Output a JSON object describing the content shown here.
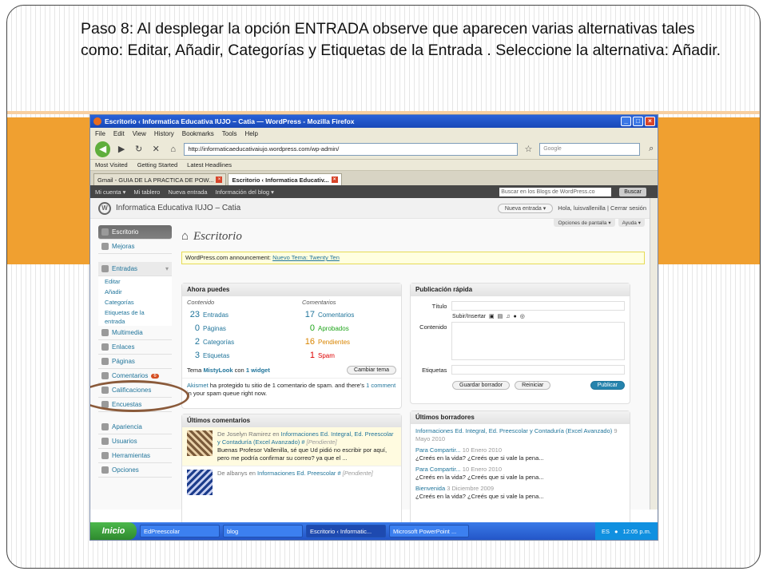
{
  "slide": {
    "heading": "Paso 8: Al desplegar la opción ENTRADA observe que aparecen varias alternativas tales como: Editar, Añadir, Categorías y Etiquetas de la Entrada . Seleccione la alternativa: Añadir."
  },
  "browser": {
    "title": "Escritorio ‹ Informatica Educativa IUJO – Catia — WordPress - Mozilla Firefox",
    "menu": [
      "File",
      "Edit",
      "View",
      "History",
      "Bookmarks",
      "Tools",
      "Help"
    ],
    "url": "http://informaticaeducativaiujo.wordpress.com/wp-admin/",
    "search_placeholder": "Google",
    "bookmarks": [
      "Most Visited",
      "Getting Started",
      "Latest Headlines"
    ],
    "tabs": [
      "Gmail - GUIA DE LA PRACTICA DE POW...",
      "Escritorio ‹ Informatica Educativ..."
    ]
  },
  "wpbar": {
    "items": [
      "Mi cuenta ▾",
      "Mi tablero",
      "Nueva entrada",
      "Información del blog ▾"
    ],
    "search_placeholder": "Buscar en los Blogs de WordPress.co",
    "search_button": "Buscar"
  },
  "header": {
    "site": "Informatica Educativa IUJO – Catia",
    "new_post": "Nueva entrada",
    "greeting": "Hola,",
    "user": "luisvallenilla",
    "logout": "Cerrar sesión"
  },
  "sidebar": {
    "escritorio": "Escritorio",
    "mejoras": "Mejoras",
    "entradas": "Entradas",
    "sub": [
      "Editar",
      "Añadir",
      "Categorías",
      "Etiquetas de la",
      "entrada"
    ],
    "items": [
      "Multimedia",
      "Enlaces",
      "Páginas",
      "Comentarios",
      "Calificaciones",
      "Encuestas"
    ],
    "comments_badge": "6",
    "items2": [
      "Apariencia",
      "Usuarios",
      "Herramientas",
      "Opciones"
    ]
  },
  "page": {
    "title": "Escritorio",
    "screen_options": "Opciones de pantalla ▾",
    "help": "Ayuda ▾",
    "notice_prefix": "WordPress.com announcement:",
    "notice_link": "Nuevo Tema: Twenty Ten"
  },
  "ahora": {
    "title": "Ahora puedes",
    "col1": "Contenido",
    "col2": "Comentarios",
    "left": [
      {
        "n": "23",
        "label": "Entradas"
      },
      {
        "n": "0",
        "label": "Páginas"
      },
      {
        "n": "2",
        "label": "Categorías"
      },
      {
        "n": "3",
        "label": "Etiquetas"
      }
    ],
    "right": [
      {
        "n": "17",
        "label": "Comentarios"
      },
      {
        "n": "0",
        "label": "Aprobados"
      },
      {
        "n": "16",
        "label": "Pendientes"
      },
      {
        "n": "1",
        "label": "Spam"
      }
    ],
    "theme_prefix": "Tema",
    "theme": "MistyLook",
    "theme_mid": "con",
    "widgets": "1 widget",
    "change_theme": "Cambiar tema",
    "akismet": "Akismet",
    "akismet_text": "ha protegido tu sitio de 1 comentario de spam. and there's",
    "akismet_link": "1 comment",
    "akismet_end": "in your spam queue right now."
  },
  "comentarios": {
    "title": "Últimos comentarios",
    "c1_author": "De Joselyn Ramirez en",
    "c1_post": "Informaciones Ed. Integral, Ed. Preescolar y Contaduría (Excel Avanzado) #",
    "c1_status": "[Pendiente]",
    "c1_text": "Buenas Profesor Vallenilla, sé que Ud pidió no escribir por aquí, pero me podría confirmar su correo? ya que el ...",
    "c2_author": "De albanys en",
    "c2_post": "Informaciones Ed. Preescolar #",
    "c2_status": "[Pendiente]"
  },
  "rapida": {
    "title": "Publicación rápida",
    "titulo": "Título",
    "subir": "Subir/Insertar",
    "contenido": "Contenido",
    "etiquetas": "Etiquetas",
    "guardar": "Guardar borrador",
    "reiniciar": "Reiniciar",
    "publicar": "Publicar"
  },
  "borradores": {
    "title": "Últimos borradores",
    "items": [
      {
        "title": "Informaciones Ed. Integral, Ed. Preescolar y Contaduría (Excel Avanzado)",
        "date": "9 Mayo 2010",
        "excerpt": ""
      },
      {
        "title": "Para Compartir...",
        "date": "10 Enero 2010",
        "excerpt": "¿Creés en la vida? ¿Creés que si vale la pena..."
      },
      {
        "title": "Para Compartir...",
        "date": "10 Enero 2010",
        "excerpt": "¿Creés en la vida? ¿Creés que si vale la pena..."
      },
      {
        "title": "Bienvenida",
        "date": "3 Diciembre 2009",
        "excerpt": "¿Creés en la vida? ¿Creés que si vale la pena..."
      }
    ]
  },
  "taskbar": {
    "start": "Inicio",
    "buttons": [
      "EdPreescolar",
      "blog",
      "Escritorio ‹ Informatic...",
      "Microsoft PowerPoint ..."
    ],
    "lang": "ES",
    "time": "12:05 p.m."
  }
}
